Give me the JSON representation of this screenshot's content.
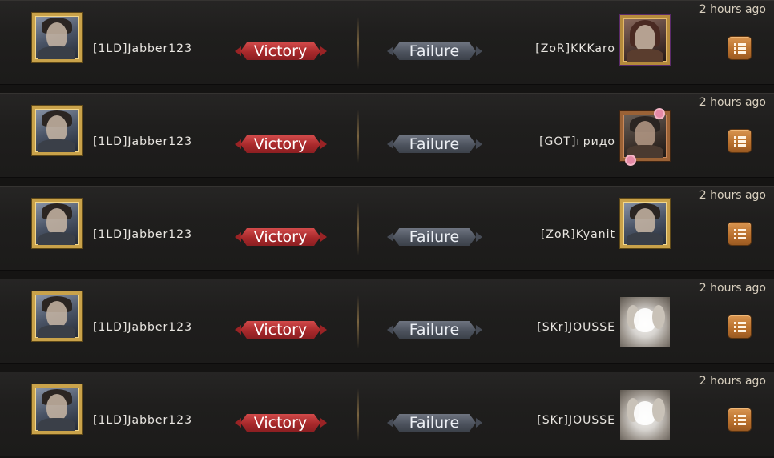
{
  "battle_log": {
    "rows": [
      {
        "time": "2 hours ago",
        "left_player": {
          "name": "[1LD]Jabber123",
          "result": "Victory",
          "frame": "gold"
        },
        "right_player": {
          "name": "[ZoR]KKKaro",
          "result": "Failure",
          "frame": "purple"
        },
        "detail_icon": "list-icon"
      },
      {
        "time": "2 hours ago",
        "left_player": {
          "name": "[1LD]Jabber123",
          "result": "Victory",
          "frame": "gold"
        },
        "right_player": {
          "name": "[GOT]гридо",
          "result": "Failure",
          "frame": "bronze-floral"
        },
        "detail_icon": "list-icon"
      },
      {
        "time": "2 hours ago",
        "left_player": {
          "name": "[1LD]Jabber123",
          "result": "Victory",
          "frame": "gold"
        },
        "right_player": {
          "name": "[ZoR]Kyanit",
          "result": "Failure",
          "frame": "gold"
        },
        "detail_icon": "list-icon"
      },
      {
        "time": "2 hours ago",
        "left_player": {
          "name": "[1LD]Jabber123",
          "result": "Victory",
          "frame": "gold"
        },
        "right_player": {
          "name": "[SKr]JOUSSE",
          "result": "Failure",
          "frame": "none-dog"
        },
        "detail_icon": "list-icon"
      },
      {
        "time": "2 hours ago",
        "left_player": {
          "name": "[1LD]Jabber123",
          "result": "Victory",
          "frame": "gold"
        },
        "right_player": {
          "name": "[SKr]JOUSSE",
          "result": "Failure",
          "frame": "none-dog"
        },
        "detail_icon": "list-icon"
      }
    ]
  },
  "colors": {
    "victory": "#b8302f",
    "failure": "#555b66",
    "button": "#c07a34",
    "frame_gold": "#c9a24a"
  }
}
